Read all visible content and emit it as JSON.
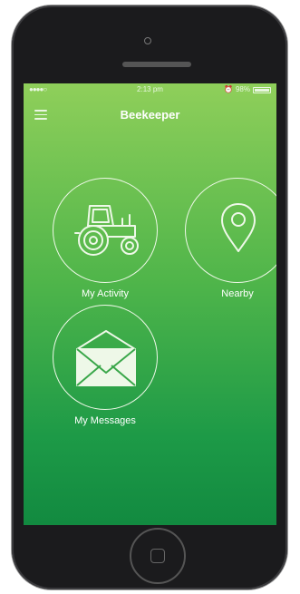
{
  "status_bar": {
    "signal": "●●●●○",
    "time": "2:13 pm",
    "battery_percent": "98%",
    "battery_level": 0.98,
    "alarm_icon": "alarm-clock-icon"
  },
  "nav": {
    "title": "Beekeeper",
    "menu_icon": "hamburger-menu-icon"
  },
  "tiles": [
    {
      "label": "My Activity",
      "icon": "tractor-icon"
    },
    {
      "label": "Nearby",
      "icon": "map-pin-icon"
    },
    {
      "label": "My Messages",
      "icon": "envelope-open-icon"
    }
  ],
  "colors": {
    "gradient_top": "#8fcf5a",
    "gradient_bottom": "#128a40",
    "foreground": "#ffffff"
  }
}
